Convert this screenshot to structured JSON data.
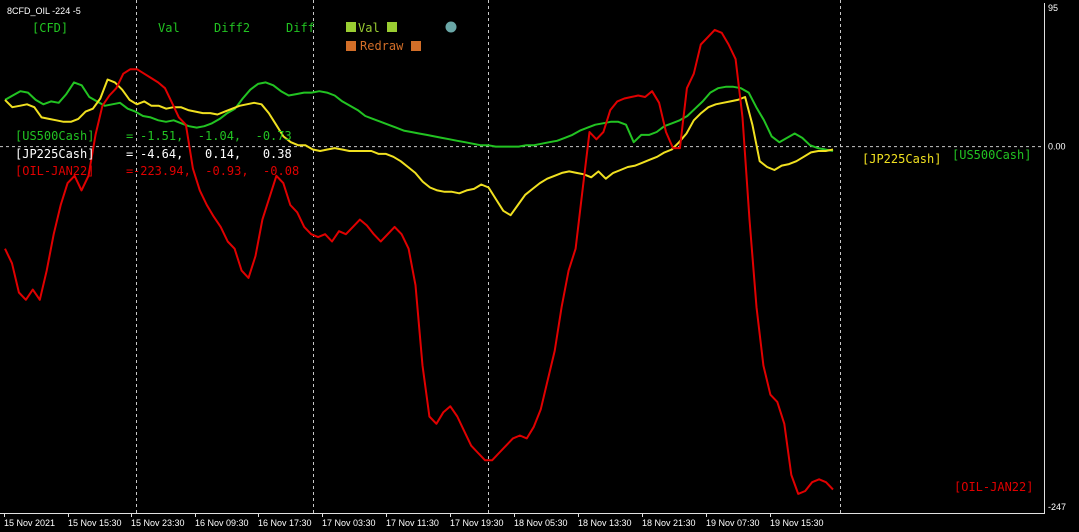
{
  "window": {
    "title": "8CFD_OIL -224 -5"
  },
  "colors": {
    "background": "#000000",
    "grid": "#c8c8c8",
    "green": "#22c322",
    "yellow": "#f0e020",
    "red": "#e00000",
    "white": "#ffffff",
    "orange": "#d26e28",
    "swatch_green": "#9acd32",
    "dot": "#6aa7a7"
  },
  "controls": {
    "cfd": "[CFD]",
    "val": "Val",
    "diff2": "Diff2",
    "diff": "Diff",
    "val_toggle": "Val",
    "redraw": "Redraw"
  },
  "readout": [
    {
      "label": "[US500Cash]",
      "eq": "=",
      "values": "-1.51,  -1.04,  -0.73",
      "color": "green"
    },
    {
      "label": "[JP225Cash]",
      "eq": "=",
      "values": "-4.64,   0.14,   0.38",
      "color": "white"
    },
    {
      "label": "[OIL-JAN22]",
      "eq": "=",
      "values": "-223.94,  -0.93,  -0.08",
      "color": "red"
    }
  ],
  "right_labels": {
    "jp": "[JP225Cash]",
    "us": "[US500Cash]",
    "oil": "[OIL-JAN22]"
  },
  "chart_data": {
    "type": "line",
    "ylim": [
      -247,
      95
    ],
    "y_ticks": [
      "95",
      "0.00",
      "-247"
    ],
    "x_tick_labels": [
      "15 Nov 2021",
      "15 Nov 15:30",
      "15 Nov 23:30",
      "16 Nov 09:30",
      "16 Nov 17:30",
      "17 Nov 03:30",
      "17 Nov 11:30",
      "17 Nov 19:30",
      "18 Nov 05:30",
      "18 Nov 13:30",
      "18 Nov 21:30",
      "19 Nov 07:30",
      "19 Nov 15:30"
    ],
    "series": [
      {
        "name": "[US500Cash]",
        "color": "green",
        "values": [
          32,
          35,
          38,
          37,
          32,
          29,
          31,
          30,
          36,
          44,
          42,
          34,
          31,
          28,
          29,
          30,
          26,
          24,
          21,
          20,
          18,
          17,
          18,
          16,
          14,
          13,
          14,
          16,
          19,
          23,
          26,
          33,
          39,
          43,
          44,
          42,
          38,
          35,
          36,
          37,
          37,
          38,
          37,
          35,
          31,
          28,
          25,
          21,
          19,
          17,
          15,
          13,
          11,
          10,
          9,
          8,
          7,
          6,
          5,
          4,
          3,
          2,
          1,
          1,
          0,
          0,
          0,
          0,
          1,
          1,
          2,
          3,
          4,
          6,
          8,
          11,
          13,
          15,
          16,
          17,
          17,
          15,
          3,
          8,
          8,
          10,
          14,
          16,
          18,
          21,
          26,
          31,
          37,
          40,
          41,
          41,
          40,
          37,
          27,
          18,
          7,
          3,
          6,
          9,
          6,
          1,
          -1,
          -2,
          -3
        ]
      },
      {
        "name": "[JP225Cash]",
        "color": "yellow",
        "values": [
          32,
          27,
          28,
          29,
          27,
          20,
          19,
          18,
          17,
          17,
          19,
          24,
          26,
          33,
          46,
          44,
          39,
          32,
          29,
          31,
          28,
          28,
          26,
          27,
          27,
          25,
          24,
          23,
          23,
          22,
          24,
          26,
          28,
          29,
          30,
          29,
          23,
          15,
          7,
          3,
          1,
          1,
          -2,
          -3,
          -2,
          -1,
          -2,
          -3,
          -3,
          -3,
          -3,
          -5,
          -5,
          -7,
          -10,
          -14,
          -18,
          -24,
          -28,
          -30,
          -31,
          -31,
          -32,
          -30,
          -29,
          -26,
          -28,
          -36,
          -44,
          -47,
          -40,
          -33,
          -29,
          -25,
          -22,
          -20,
          -18,
          -17,
          -18,
          -19,
          -21,
          -17,
          -22,
          -18,
          -16,
          -14,
          -13,
          -11,
          -9,
          -7,
          -4,
          -2,
          3,
          9,
          18,
          23,
          27,
          29,
          30,
          31,
          32,
          34,
          15,
          -10,
          -14,
          -16,
          -13,
          -12,
          -10,
          -7,
          -4,
          -3,
          -3,
          -2
        ]
      },
      {
        "name": "[OIL-JAN22]",
        "color": "red",
        "values": [
          -70,
          -80,
          -100,
          -105,
          -98,
          -105,
          -85,
          -60,
          -40,
          -25,
          -20,
          -30,
          -20,
          8,
          28,
          35,
          40,
          50,
          53,
          53,
          50,
          47,
          44,
          40,
          30,
          20,
          15,
          -15,
          -30,
          -40,
          -48,
          -55,
          -65,
          -70,
          -85,
          -90,
          -75,
          -50,
          -35,
          -20,
          -25,
          -40,
          -45,
          -55,
          -60,
          -62,
          -60,
          -65,
          -58,
          -60,
          -55,
          -50,
          -54,
          -60,
          -65,
          -60,
          -55,
          -60,
          -70,
          -95,
          -150,
          -185,
          -190,
          -182,
          -178,
          -185,
          -195,
          -205,
          -210,
          -215,
          -215,
          -210,
          -205,
          -200,
          -198,
          -200,
          -192,
          -180,
          -160,
          -140,
          -110,
          -85,
          -70,
          -30,
          10,
          5,
          10,
          25,
          31,
          33,
          34,
          35,
          34,
          38,
          30,
          10,
          -1,
          -1,
          40,
          50,
          70,
          75,
          80,
          78,
          70,
          60,
          20,
          -50,
          -110,
          -150,
          -170,
          -175,
          -190,
          -225,
          -238,
          -236,
          -230,
          -228,
          -230,
          -235
        ]
      }
    ]
  }
}
